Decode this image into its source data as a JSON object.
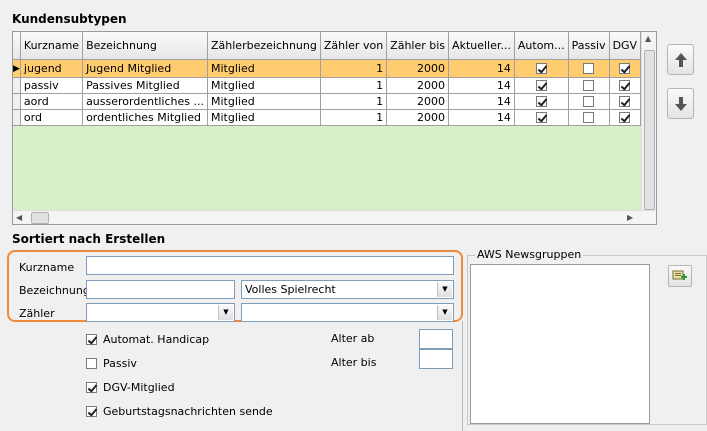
{
  "section_title": "Kundensubtypen",
  "grid": {
    "columns": [
      "Kurzname",
      "Bezeichnung",
      "Zählerbezeichnung",
      "Zähler von",
      "Zähler bis",
      "Aktueller...",
      "Autom...",
      "Passiv",
      "DGV"
    ],
    "rows": [
      {
        "kurzname": "jugend",
        "bezeichnung": "Jugend Mitglied",
        "zaehler": "Mitglied",
        "von": "1",
        "bis": "2000",
        "aktuell": "14",
        "autom": true,
        "passiv": false,
        "dgv": true
      },
      {
        "kurzname": "passiv",
        "bezeichnung": "Passives Mitglied",
        "zaehler": "Mitglied",
        "von": "1",
        "bis": "2000",
        "aktuell": "14",
        "autom": true,
        "passiv": false,
        "dgv": true
      },
      {
        "kurzname": "aord",
        "bezeichnung": "ausserordentliches ...",
        "zaehler": "Mitglied",
        "von": "1",
        "bis": "2000",
        "aktuell": "14",
        "autom": true,
        "passiv": false,
        "dgv": true
      },
      {
        "kurzname": "ord",
        "bezeichnung": "ordentliches Mitglied",
        "zaehler": "Mitglied",
        "von": "1",
        "bis": "2000",
        "aktuell": "14",
        "autom": true,
        "passiv": false,
        "dgv": true
      }
    ],
    "selected_row_index": 0,
    "colors": {
      "selected": "#ffcc70",
      "empty_area": "#d9efc8"
    }
  },
  "sort_title": "Sortiert nach Erstellen",
  "form": {
    "kurzname_label": "Kurzname",
    "kurzname_value": "",
    "bezeichnung_label": "Bezeichnung",
    "bezeichnung_value": "",
    "spielrecht_value": "Volles Spielrecht",
    "zaehler_label": "Zähler",
    "zaehler_value": "",
    "zaehler2_value": "",
    "highlight_color": "#f08a3c"
  },
  "options": {
    "automat_handicap": {
      "label": "Automat. Handicap",
      "checked": true
    },
    "passiv": {
      "label": "Passiv",
      "checked": false
    },
    "dgv_mitglied": {
      "label": "DGV-Mitglied",
      "checked": true
    },
    "geburtstag": {
      "label": "Geburtstagsnachrichten sende",
      "checked": true
    }
  },
  "alter_ab_label": "Alter ab",
  "alter_bis_label": "Alter bis",
  "alter_ab_value": "",
  "alter_bis_value": "",
  "aws_group_title": "AWS Newsgruppen",
  "icons": {
    "up": "arrow-up-icon",
    "down": "arrow-down-icon",
    "add": "add-group-icon"
  }
}
